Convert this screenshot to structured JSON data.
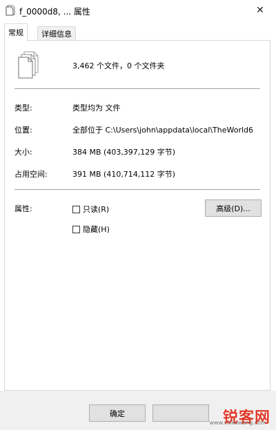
{
  "window": {
    "title": "f_0000d8, ... 属性",
    "close_symbol": "✕"
  },
  "tabs": [
    {
      "label": "常规",
      "active": true
    },
    {
      "label": "详细信息",
      "active": false
    }
  ],
  "general": {
    "summary": "3,462 个文件，0 个文件夹",
    "type_label": "类型:",
    "type_value": "类型均为 文件",
    "location_label": "位置:",
    "location_value": "全部位于 C:\\Users\\john\\appdata\\local\\TheWorld6",
    "size_label": "大小:",
    "size_value": "384 MB (403,397,129 字节)",
    "disk_size_label": "占用空间:",
    "disk_size_value": "391 MB (410,714,112 字节)",
    "attributes_label": "属性:",
    "readonly_label": "只读(R)",
    "hidden_label": "隐藏(H)",
    "advanced_label": "高级(D)..."
  },
  "buttons": {
    "ok_label": "确定"
  },
  "watermark": {
    "logo_text": "锐客网",
    "url_text": "www.ruikewang.com"
  },
  "colors": {
    "accent": "#0078d7",
    "watermark": "#e03a2a"
  },
  "icons": {
    "title": "files-icon",
    "close": "close-icon",
    "summary": "multiple-files-icon"
  }
}
